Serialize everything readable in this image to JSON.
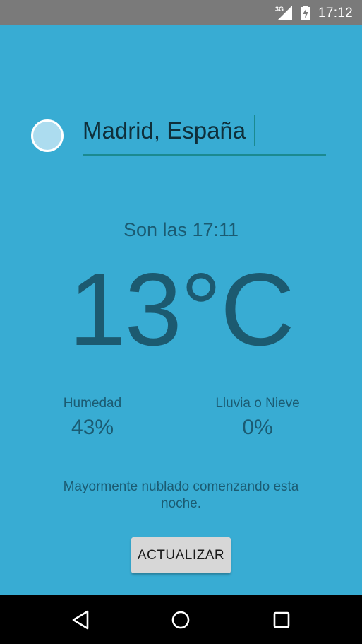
{
  "status_bar": {
    "network_type": "3G",
    "time": "17:12"
  },
  "location": {
    "value": "Madrid, España",
    "icon": "location-circle-icon"
  },
  "weather": {
    "time_label": "Son las 17:11",
    "temperature": "13°C",
    "humidity": {
      "label": "Humedad",
      "value": "43%"
    },
    "precipitation": {
      "label": "Lluvia o Nieve",
      "value": "0%"
    },
    "summary": "Mayormente nublado comenzando esta noche."
  },
  "actions": {
    "refresh_label": "ACTUALIZAR"
  },
  "navigation": {
    "back": "back-icon",
    "home": "home-icon",
    "recents": "recents-icon"
  },
  "colors": {
    "background": "#38acd3",
    "text": "#1b5b72",
    "accent": "#1b8a90",
    "button": "#d7d7d7",
    "status_bar": "#7a7a7a",
    "nav_bar": "#000000"
  }
}
